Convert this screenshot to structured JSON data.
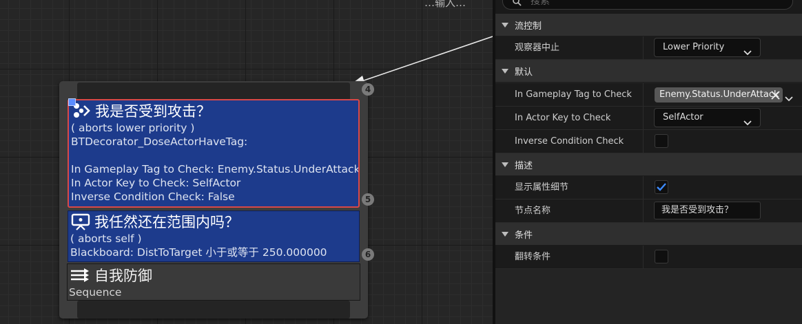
{
  "graph": {
    "top_partial_text": "…输入…",
    "node": {
      "decorators": [
        {
          "title": "我是否受到攻击？",
          "icon": "blackboard-decorator-icon",
          "lines": [
            "( aborts lower priority )",
            "BTDecorator_DoseActorHaveTag:",
            "",
            "In Gameplay Tag to Check: Enemy.Status.UnderAttack",
            "In Actor Key to Check: SelfActor",
            "Inverse Condition Check: False"
          ],
          "selected": true,
          "badge": "5"
        },
        {
          "title": "我任然还在范围内吗？",
          "icon": "monitor-decorator-icon",
          "lines": [
            "( aborts self )",
            "Blackboard: DistToTarget 小于或等于 250.000000"
          ],
          "selected": false,
          "badge": "6"
        }
      ],
      "task": {
        "title": "自我防御",
        "icon": "sequence-icon",
        "subtitle": "Sequence"
      },
      "top_badge": "4"
    }
  },
  "details": {
    "search_placeholder": "搜索",
    "sections": [
      {
        "title": "流控制",
        "rows": [
          {
            "name": "观察器中止",
            "type": "combo",
            "value": "Lower Priority"
          }
        ]
      },
      {
        "title": "默认",
        "rows": [
          {
            "name": "In Gameplay Tag to Check",
            "type": "tag",
            "value": "Enemy.Status.UnderAttack"
          },
          {
            "name": "In Actor Key to Check",
            "type": "combo",
            "value": "SelfActor"
          },
          {
            "name": "Inverse Condition Check",
            "type": "checkbox",
            "checked": false
          }
        ]
      },
      {
        "title": "描述",
        "rows": [
          {
            "name": "显示属性细节",
            "type": "checkbox",
            "checked": true
          },
          {
            "name": "节点名称",
            "type": "text",
            "value": "我是否受到攻击？"
          }
        ]
      },
      {
        "title": "条件",
        "rows": [
          {
            "name": "翻转条件",
            "type": "checkbox",
            "checked": false
          }
        ]
      }
    ]
  },
  "colors": {
    "decorator_bg": "#1d3b8c",
    "selected_border": "#d94848",
    "checkbox_check": "#3d8bff"
  }
}
